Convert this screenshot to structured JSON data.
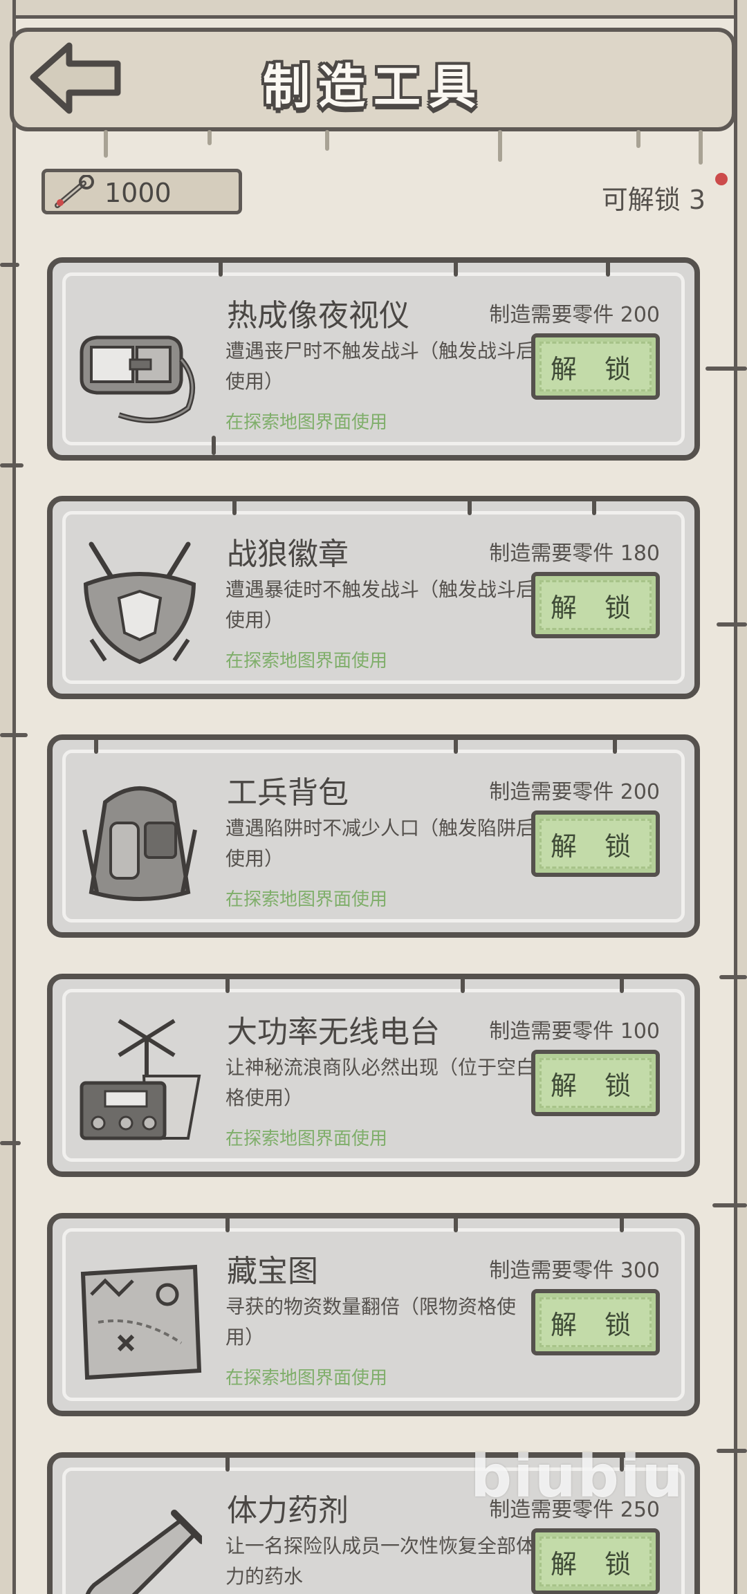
{
  "header": {
    "title": "制造工具"
  },
  "parts": {
    "value": "1000"
  },
  "unlockable": {
    "label": "可解锁 3"
  },
  "unlock_label": "解 锁",
  "items": [
    {
      "name": "热成像夜视仪",
      "cost": "制造需要零件 200",
      "desc": "遭遇丧尸时不触发战斗（触发战斗后使用）",
      "hint": "在探索地图界面使用",
      "icon": "thermal-goggles-icon"
    },
    {
      "name": "战狼徽章",
      "cost": "制造需要零件 180",
      "desc": "遭遇暴徒时不触发战斗（触发战斗后使用）",
      "hint": "在探索地图界面使用",
      "icon": "wolf-badge-icon"
    },
    {
      "name": "工兵背包",
      "cost": "制造需要零件 200",
      "desc": "遭遇陷阱时不减少人口（触发陷阱后使用）",
      "hint": "在探索地图界面使用",
      "icon": "backpack-icon"
    },
    {
      "name": "大功率无线电台",
      "cost": "制造需要零件 100",
      "desc": "让神秘流浪商队必然出现（位于空白格使用）",
      "hint": "在探索地图界面使用",
      "icon": "radio-icon"
    },
    {
      "name": "藏宝图",
      "cost": "制造需要零件 300",
      "desc": "寻获的物资数量翻倍（限物资格使用）",
      "hint": "在探索地图界面使用",
      "icon": "treasure-map-icon"
    },
    {
      "name": "体力药剂",
      "cost": "制造需要零件 250",
      "desc": "让一名探险队成员一次性恢复全部体力的药水",
      "hint": "",
      "icon": "potion-icon"
    }
  ],
  "watermark": "biubiu",
  "colors": {
    "unlock_green": "#c3dba9",
    "hint_green": "#7fae6a",
    "border": "#55514d",
    "dot_red": "#cc4b4b"
  }
}
